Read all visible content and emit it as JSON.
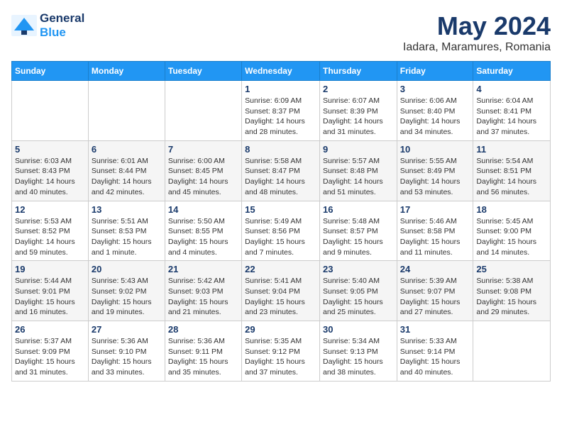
{
  "logo": {
    "line1": "General",
    "line2": "Blue"
  },
  "title": "May 2024",
  "subtitle": "Iadara, Maramures, Romania",
  "days_of_week": [
    "Sunday",
    "Monday",
    "Tuesday",
    "Wednesday",
    "Thursday",
    "Friday",
    "Saturday"
  ],
  "weeks": [
    {
      "days": [
        {
          "number": "",
          "info": ""
        },
        {
          "number": "",
          "info": ""
        },
        {
          "number": "",
          "info": ""
        },
        {
          "number": "1",
          "info": "Sunrise: 6:09 AM\nSunset: 8:37 PM\nDaylight: 14 hours\nand 28 minutes."
        },
        {
          "number": "2",
          "info": "Sunrise: 6:07 AM\nSunset: 8:39 PM\nDaylight: 14 hours\nand 31 minutes."
        },
        {
          "number": "3",
          "info": "Sunrise: 6:06 AM\nSunset: 8:40 PM\nDaylight: 14 hours\nand 34 minutes."
        },
        {
          "number": "4",
          "info": "Sunrise: 6:04 AM\nSunset: 8:41 PM\nDaylight: 14 hours\nand 37 minutes."
        }
      ]
    },
    {
      "days": [
        {
          "number": "5",
          "info": "Sunrise: 6:03 AM\nSunset: 8:43 PM\nDaylight: 14 hours\nand 40 minutes."
        },
        {
          "number": "6",
          "info": "Sunrise: 6:01 AM\nSunset: 8:44 PM\nDaylight: 14 hours\nand 42 minutes."
        },
        {
          "number": "7",
          "info": "Sunrise: 6:00 AM\nSunset: 8:45 PM\nDaylight: 14 hours\nand 45 minutes."
        },
        {
          "number": "8",
          "info": "Sunrise: 5:58 AM\nSunset: 8:47 PM\nDaylight: 14 hours\nand 48 minutes."
        },
        {
          "number": "9",
          "info": "Sunrise: 5:57 AM\nSunset: 8:48 PM\nDaylight: 14 hours\nand 51 minutes."
        },
        {
          "number": "10",
          "info": "Sunrise: 5:55 AM\nSunset: 8:49 PM\nDaylight: 14 hours\nand 53 minutes."
        },
        {
          "number": "11",
          "info": "Sunrise: 5:54 AM\nSunset: 8:51 PM\nDaylight: 14 hours\nand 56 minutes."
        }
      ]
    },
    {
      "days": [
        {
          "number": "12",
          "info": "Sunrise: 5:53 AM\nSunset: 8:52 PM\nDaylight: 14 hours\nand 59 minutes."
        },
        {
          "number": "13",
          "info": "Sunrise: 5:51 AM\nSunset: 8:53 PM\nDaylight: 15 hours\nand 1 minute."
        },
        {
          "number": "14",
          "info": "Sunrise: 5:50 AM\nSunset: 8:55 PM\nDaylight: 15 hours\nand 4 minutes."
        },
        {
          "number": "15",
          "info": "Sunrise: 5:49 AM\nSunset: 8:56 PM\nDaylight: 15 hours\nand 7 minutes."
        },
        {
          "number": "16",
          "info": "Sunrise: 5:48 AM\nSunset: 8:57 PM\nDaylight: 15 hours\nand 9 minutes."
        },
        {
          "number": "17",
          "info": "Sunrise: 5:46 AM\nSunset: 8:58 PM\nDaylight: 15 hours\nand 11 minutes."
        },
        {
          "number": "18",
          "info": "Sunrise: 5:45 AM\nSunset: 9:00 PM\nDaylight: 15 hours\nand 14 minutes."
        }
      ]
    },
    {
      "days": [
        {
          "number": "19",
          "info": "Sunrise: 5:44 AM\nSunset: 9:01 PM\nDaylight: 15 hours\nand 16 minutes."
        },
        {
          "number": "20",
          "info": "Sunrise: 5:43 AM\nSunset: 9:02 PM\nDaylight: 15 hours\nand 19 minutes."
        },
        {
          "number": "21",
          "info": "Sunrise: 5:42 AM\nSunset: 9:03 PM\nDaylight: 15 hours\nand 21 minutes."
        },
        {
          "number": "22",
          "info": "Sunrise: 5:41 AM\nSunset: 9:04 PM\nDaylight: 15 hours\nand 23 minutes."
        },
        {
          "number": "23",
          "info": "Sunrise: 5:40 AM\nSunset: 9:05 PM\nDaylight: 15 hours\nand 25 minutes."
        },
        {
          "number": "24",
          "info": "Sunrise: 5:39 AM\nSunset: 9:07 PM\nDaylight: 15 hours\nand 27 minutes."
        },
        {
          "number": "25",
          "info": "Sunrise: 5:38 AM\nSunset: 9:08 PM\nDaylight: 15 hours\nand 29 minutes."
        }
      ]
    },
    {
      "days": [
        {
          "number": "26",
          "info": "Sunrise: 5:37 AM\nSunset: 9:09 PM\nDaylight: 15 hours\nand 31 minutes."
        },
        {
          "number": "27",
          "info": "Sunrise: 5:36 AM\nSunset: 9:10 PM\nDaylight: 15 hours\nand 33 minutes."
        },
        {
          "number": "28",
          "info": "Sunrise: 5:36 AM\nSunset: 9:11 PM\nDaylight: 15 hours\nand 35 minutes."
        },
        {
          "number": "29",
          "info": "Sunrise: 5:35 AM\nSunset: 9:12 PM\nDaylight: 15 hours\nand 37 minutes."
        },
        {
          "number": "30",
          "info": "Sunrise: 5:34 AM\nSunset: 9:13 PM\nDaylight: 15 hours\nand 38 minutes."
        },
        {
          "number": "31",
          "info": "Sunrise: 5:33 AM\nSunset: 9:14 PM\nDaylight: 15 hours\nand 40 minutes."
        },
        {
          "number": "",
          "info": ""
        }
      ]
    }
  ]
}
